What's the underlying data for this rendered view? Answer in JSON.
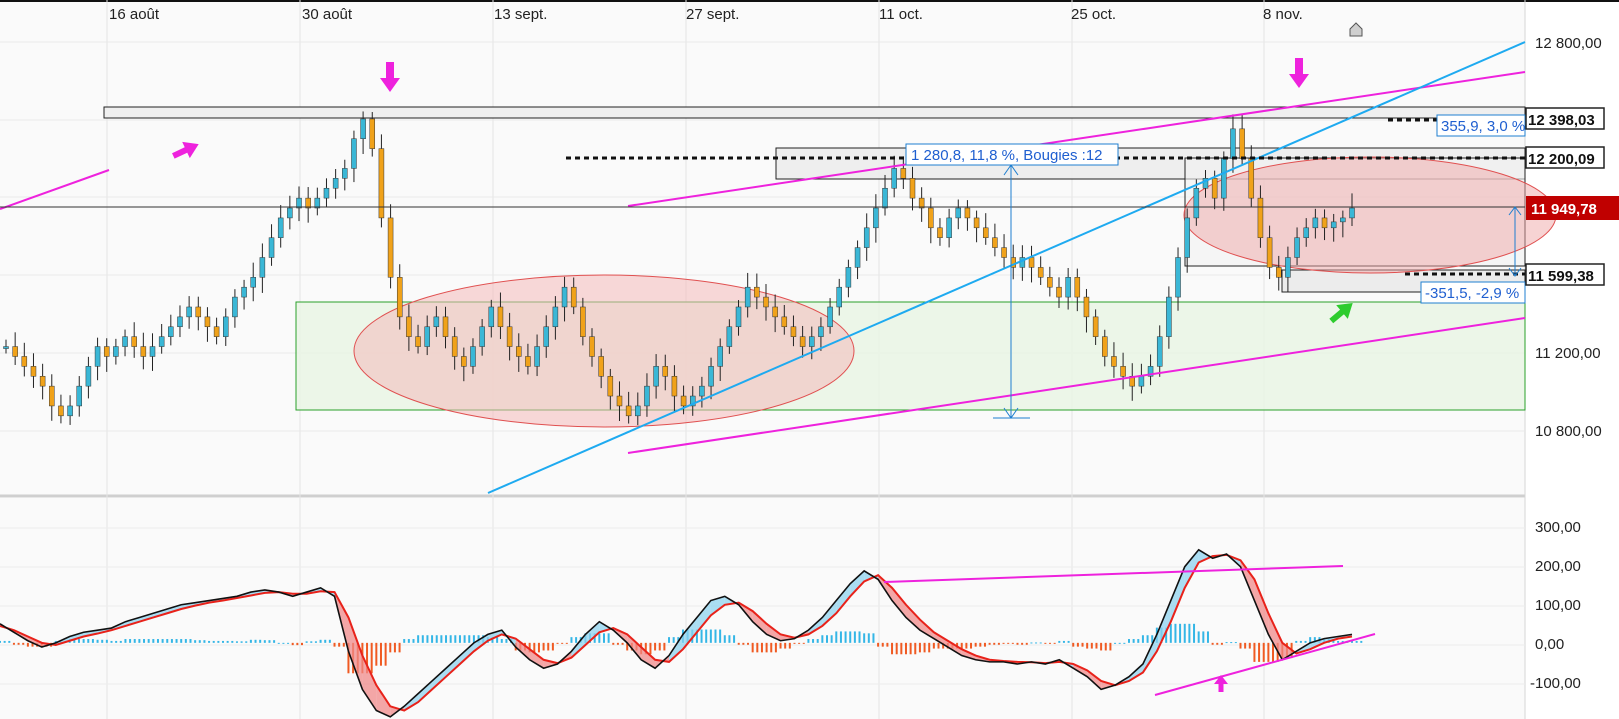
{
  "chart_data": [
    {
      "type": "candlestick",
      "x_ticks": [
        "16 août",
        "30 août",
        "13 sept.",
        "27 sept.",
        "11 oct.",
        "25 oct.",
        "8 nov."
      ],
      "y_ticks": [
        "12 800,00",
        "11 200,00",
        "10 800,00"
      ],
      "ylim": [
        10500,
        12900
      ],
      "grid": true,
      "price_tags": [
        {
          "label": "12 398,03",
          "value": 12398.03,
          "style": "outline"
        },
        {
          "label": "12 200,09",
          "value": 12200.09,
          "style": "outline"
        },
        {
          "label": "11 949,78",
          "value": 11949.78,
          "style": "last",
          "color": "#c00000"
        },
        {
          "label": "11 599,38",
          "value": 11599.38,
          "style": "outline"
        }
      ],
      "annotations": [
        {
          "label": "1 280,8, 11,8 %, Bougies :12",
          "kind": "measure"
        },
        {
          "label": "355,9, 3,0 %",
          "kind": "measure"
        },
        {
          "label": "-351,5, -2,9 %",
          "kind": "measure"
        }
      ],
      "close_series": [
        11250,
        11200,
        11150,
        11100,
        11050,
        10950,
        10900,
        10950,
        11050,
        11150,
        11250,
        11200,
        11250,
        11300,
        11250,
        11200,
        11250,
        11300,
        11350,
        11400,
        11450,
        11400,
        11350,
        11300,
        11400,
        11500,
        11550,
        11600,
        11700,
        11800,
        11900,
        11950,
        12000,
        11950,
        12000,
        12050,
        12100,
        12150,
        12300,
        12400,
        12250,
        11900,
        11600,
        11400,
        11300,
        11250,
        11350,
        11400,
        11300,
        11200,
        11150,
        11250,
        11350,
        11450,
        11350,
        11250,
        11200,
        11150,
        11250,
        11350,
        11450,
        11550,
        11450,
        11300,
        11200,
        11100,
        11000,
        10950,
        10900,
        10950,
        11050,
        11150,
        11100,
        11000,
        10950,
        11000,
        11050,
        11150,
        11250,
        11350,
        11450,
        11550,
        11500,
        11450,
        11400,
        11350,
        11300,
        11250,
        11300,
        11350,
        11450,
        11550,
        11650,
        11750,
        11850,
        11950,
        12050,
        12150,
        12100,
        12000,
        11950,
        11850,
        11800,
        11900,
        11950,
        11900,
        11850,
        11800,
        11750,
        11700,
        11650,
        11700,
        11650,
        11600,
        11550,
        11500,
        11600,
        11500,
        11400,
        11300,
        11200,
        11150,
        11100,
        11050,
        11100,
        11150,
        11300,
        11500,
        11700,
        11900,
        12050,
        12100,
        12000,
        12200,
        12350,
        12200,
        12000,
        11800,
        11650,
        11600,
        11700,
        11800,
        11850,
        11900,
        11850,
        11880,
        11900,
        11950
      ]
    },
    {
      "type": "line",
      "y_ticks": [
        "300,00",
        "200,00",
        "100,00",
        "0,00",
        "-100,00"
      ],
      "ylim": [
        -180,
        340
      ],
      "grid": true,
      "macd": [
        45,
        25,
        5,
        -10,
        0,
        15,
        25,
        30,
        35,
        50,
        60,
        70,
        80,
        90,
        95,
        100,
        105,
        110,
        120,
        125,
        120,
        110,
        120,
        130,
        110,
        -20,
        -110,
        -160,
        -175,
        -150,
        -120,
        -90,
        -60,
        -30,
        0,
        20,
        30,
        -10,
        -40,
        -60,
        -50,
        -20,
        20,
        50,
        30,
        0,
        -40,
        -60,
        -30,
        20,
        60,
        100,
        110,
        90,
        50,
        20,
        5,
        10,
        30,
        60,
        100,
        140,
        170,
        150,
        100,
        60,
        30,
        10,
        -10,
        -30,
        -40,
        -45,
        -45,
        -50,
        -45,
        -50,
        -40,
        -60,
        -80,
        -110,
        -100,
        -80,
        -50,
        20,
        100,
        180,
        220,
        200,
        210,
        180,
        100,
        20,
        -40,
        -20,
        0,
        10,
        15,
        20
      ],
      "signal": [
        40,
        30,
        15,
        0,
        -5,
        5,
        15,
        22,
        30,
        40,
        50,
        60,
        70,
        80,
        88,
        95,
        100,
        106,
        112,
        118,
        120,
        116,
        116,
        122,
        120,
        60,
        -30,
        -100,
        -150,
        -160,
        -140,
        -110,
        -80,
        -50,
        -20,
        5,
        20,
        10,
        -15,
        -40,
        -48,
        -35,
        -5,
        25,
        35,
        20,
        -10,
        -40,
        -45,
        -15,
        25,
        65,
        90,
        95,
        75,
        45,
        20,
        12,
        20,
        40,
        70,
        110,
        145,
        160,
        130,
        90,
        55,
        25,
        5,
        -15,
        -30,
        -40,
        -43,
        -45,
        -46,
        -48,
        -45,
        -50,
        -65,
        -90,
        -100,
        -90,
        -70,
        -20,
        50,
        130,
        190,
        205,
        208,
        195,
        150,
        70,
        0,
        -25,
        -15,
        0,
        10,
        15
      ]
    }
  ]
}
